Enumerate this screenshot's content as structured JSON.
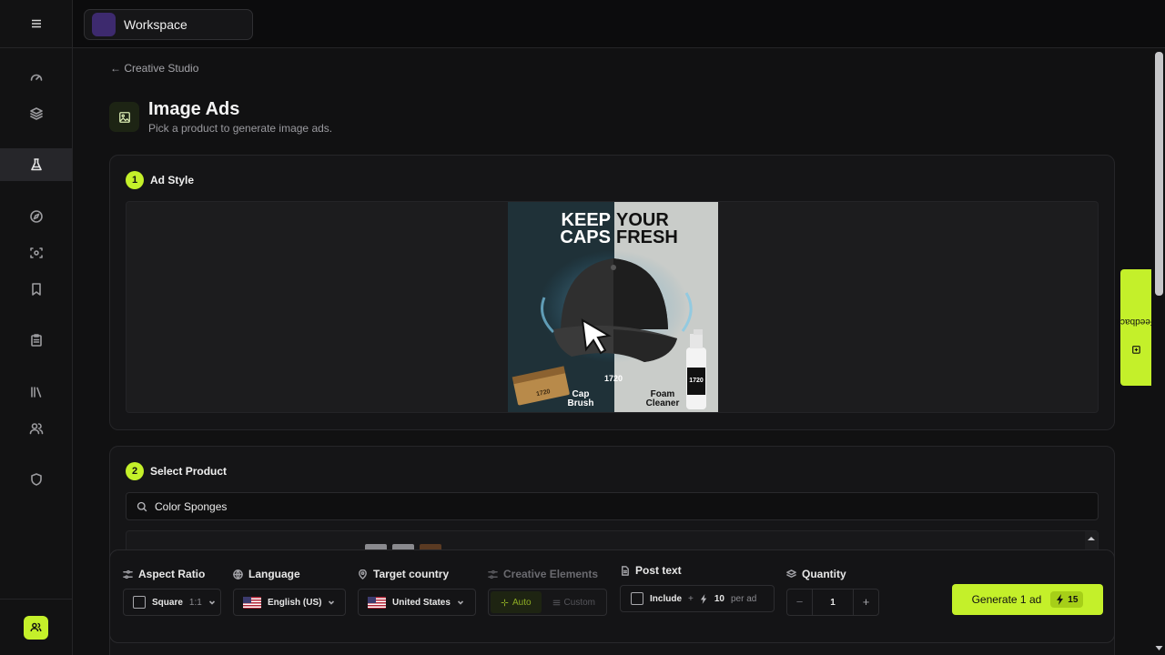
{
  "workspace": {
    "name": "Workspace"
  },
  "breadcrumb": {
    "label": "← Creative Studio"
  },
  "page": {
    "title": "Image Ads",
    "subtitle": "Pick a product to generate image ads."
  },
  "steps": [
    {
      "number": "1",
      "label": "Ad Style"
    },
    {
      "number": "2",
      "label": "Select Product"
    }
  ],
  "ad_preview": {
    "headline_left": [
      "KEEP",
      "CAPS"
    ],
    "headline_right": [
      "YOUR",
      "FRESH"
    ],
    "label_left": [
      "Cap",
      "Brush"
    ],
    "label_right": [
      "Foam",
      "Cleaner"
    ],
    "brand": "1720"
  },
  "search": {
    "value": "Color Sponges"
  },
  "controls": {
    "aspect_ratio": {
      "label": "Aspect Ratio",
      "value": "Square",
      "ratio": "1:1"
    },
    "language": {
      "label": "Language",
      "value": "English (US)"
    },
    "target_country": {
      "label": "Target country",
      "value": "United States"
    },
    "creative_elements": {
      "label": "Creative Elements",
      "auto": "Auto",
      "custom": "Custom"
    },
    "post_text": {
      "label": "Post text",
      "include": "Include",
      "plus": "+",
      "credits": "10",
      "suffix": "per ad"
    },
    "quantity": {
      "label": "Quantity",
      "value": "1",
      "minus": "−",
      "plus": "+"
    }
  },
  "generate": {
    "label": "Generate 1 ad",
    "credits": "15"
  },
  "feedback": {
    "label": "Feedback"
  },
  "colors": {
    "accent": "#c4f02a",
    "bg": "#111112"
  }
}
